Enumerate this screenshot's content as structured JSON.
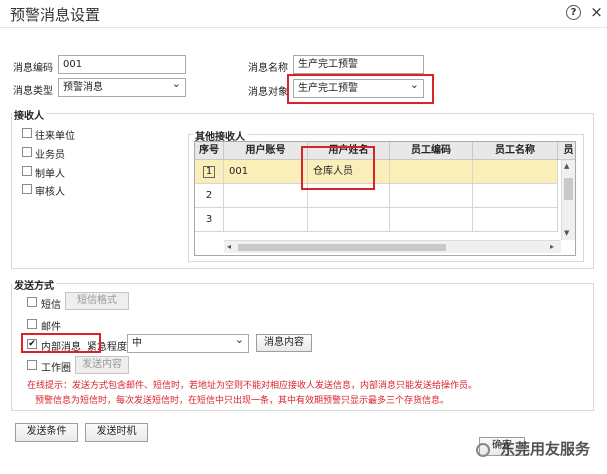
{
  "window": {
    "title": "预警消息设置",
    "help_icon": "?",
    "close_icon": "×"
  },
  "form": {
    "code_label": "消息编码",
    "code_value": "001",
    "name_label": "消息名称",
    "name_value": "生产完工预警",
    "type_label": "消息类型",
    "type_value": "预警消息",
    "object_label": "消息对象",
    "object_value": "生产完工预警"
  },
  "recipients": {
    "legend": "接收人",
    "options": [
      {
        "label": "往来单位",
        "checked": false
      },
      {
        "label": "业务员",
        "checked": false
      },
      {
        "label": "制单人",
        "checked": false
      },
      {
        "label": "审核人",
        "checked": false
      }
    ],
    "others_legend": "其他接收人",
    "columns": [
      "序号",
      "用户账号",
      "用户姓名",
      "员工编码",
      "员工名称",
      "员"
    ],
    "rows": [
      {
        "no": "1",
        "account": "001",
        "name": "仓库人员",
        "emp_code": "",
        "emp_name": ""
      },
      {
        "no": "2",
        "account": "",
        "name": "",
        "emp_code": "",
        "emp_name": ""
      },
      {
        "no": "3",
        "account": "",
        "name": "",
        "emp_code": "",
        "emp_name": ""
      }
    ]
  },
  "send": {
    "legend": "发送方式",
    "sms_label": "短信",
    "sms_checked": false,
    "sms_format_button": "短信格式",
    "mail_label": "邮件",
    "mail_checked": false,
    "internal_label": "内部消息",
    "internal_checked": true,
    "urgency_label": "紧急程度",
    "urgency_value": "中",
    "content_button": "消息内容",
    "wechat_label": "工作圈",
    "wechat_checked": false,
    "wechat_content_button": "发送内容",
    "note_line1": "在线提示：发送方式包含邮件、短信时，若地址为空则不能对相应接收人发送信息，内部消息只能发送给操作员。",
    "note_line2": "预警信息为短信时，每次发送短信时，在短信中只出现一条，其中有效期预警只显示最多三个存货信息。"
  },
  "footer": {
    "send_condition_button": "发送条件",
    "send_time_button": "发送时机",
    "confirm_button": "确定",
    "watermark": "东莞用友服务"
  }
}
